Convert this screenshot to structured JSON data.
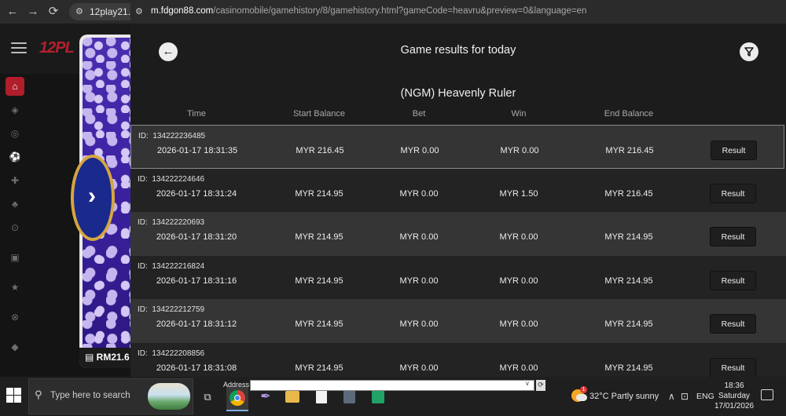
{
  "back_window": {
    "url_short": "12play21.co",
    "logo_text": "12PL",
    "balance": "RM21.6"
  },
  "front_window": {
    "url": {
      "host": "m.fdgon88.com",
      "path": "/casinomobile/gamehistory/8/gamehistory.html?gameCode=heavru&preview=0&language=en"
    },
    "title": "Game results for today",
    "game_name": "(NGM) Heavenly Ruler",
    "columns": [
      "Time",
      "Start Balance",
      "Bet",
      "Win",
      "End Balance"
    ],
    "rows": [
      {
        "id": "134222236485",
        "time": "2026-01-17  18:31:35",
        "start": "MYR 216.45",
        "bet": "MYR 0.00",
        "win": "MYR 0.00",
        "end": "MYR 216.45",
        "action": "Result"
      },
      {
        "id": "134222224646",
        "time": "2026-01-17  18:31:24",
        "start": "MYR 214.95",
        "bet": "MYR 0.00",
        "win": "MYR 1.50",
        "end": "MYR 216.45",
        "action": "Result"
      },
      {
        "id": "134222220693",
        "time": "2026-01-17  18:31:20",
        "start": "MYR 214.95",
        "bet": "MYR 0.00",
        "win": "MYR 0.00",
        "end": "MYR 214.95",
        "action": "Result"
      },
      {
        "id": "134222216824",
        "time": "2026-01-17  18:31:16",
        "start": "MYR 214.95",
        "bet": "MYR 0.00",
        "win": "MYR 0.00",
        "end": "MYR 214.95",
        "action": "Result"
      },
      {
        "id": "134222212759",
        "time": "2026-01-17  18:31:12",
        "start": "MYR 214.95",
        "bet": "MYR 0.00",
        "win": "MYR 0.00",
        "end": "MYR 214.95",
        "action": "Result"
      },
      {
        "id": "134222208856",
        "time": "2026-01-17  18:31:08",
        "start": "MYR 214.95",
        "bet": "MYR 0.00",
        "win": "MYR 0.00",
        "end": "MYR 214.95",
        "action": "Result"
      }
    ]
  },
  "taskbar": {
    "search_placeholder": "Type here to search",
    "address_label": "Address",
    "weather": "32°C  Partly sunny",
    "weather_badge": "1",
    "language": "ENG",
    "time": "18:36",
    "day": "Saturday",
    "date": "17/01/2026"
  },
  "icons": {
    "back": "arrow-left-icon",
    "filter": "funnel-icon",
    "start": "windows-logo-icon",
    "search": "search-icon",
    "browser": "chrome-icon"
  },
  "colors": {
    "accent_red": "#b01d2b",
    "row_dark": "#232323",
    "row_light": "#353535",
    "page_bg": "#1c1c1c"
  }
}
